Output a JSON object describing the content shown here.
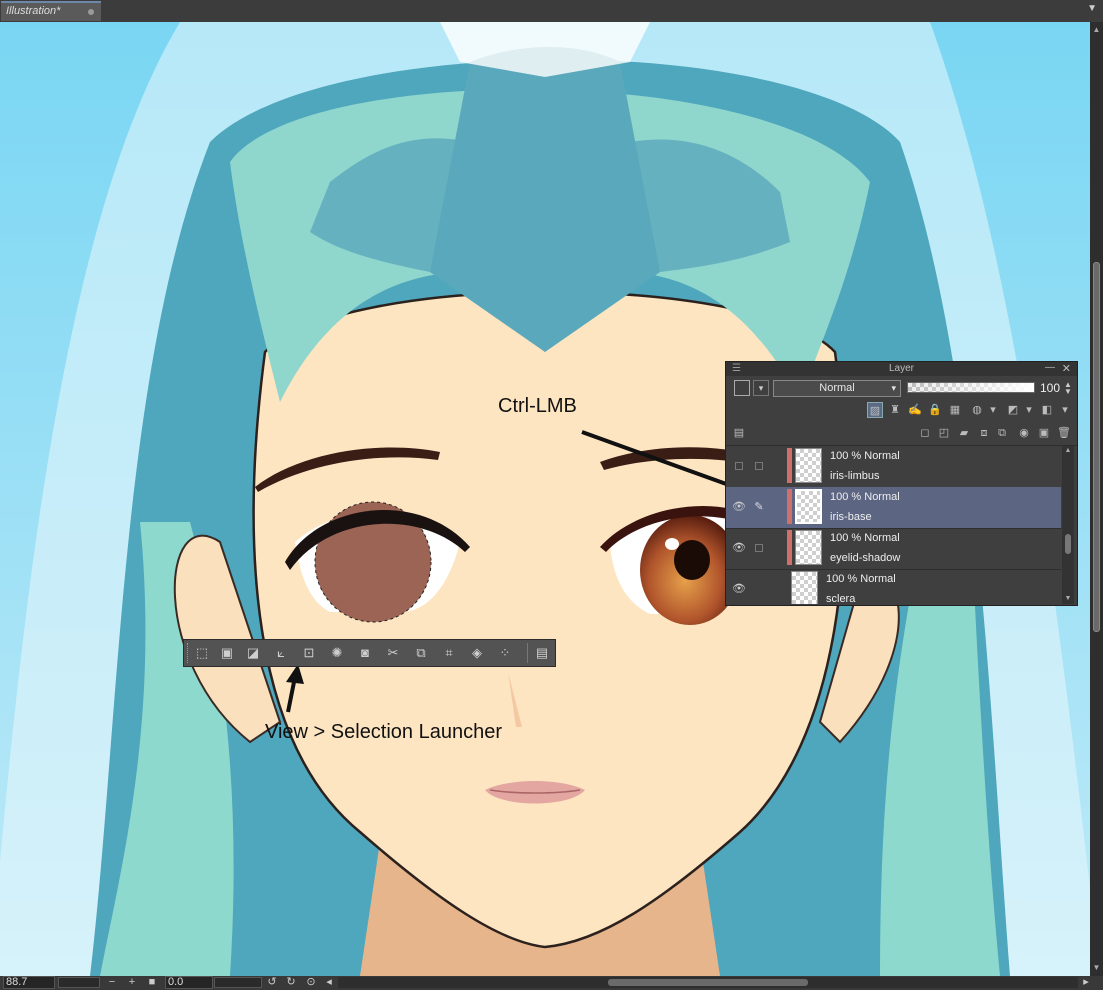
{
  "document_tab": {
    "title": "Illustration*"
  },
  "annotations": {
    "ctrl_lmb": "Ctrl-LMB",
    "selection_launcher": "View > Selection Launcher"
  },
  "status_bar": {
    "zoom": "88.7",
    "rotation": "0.0"
  },
  "selection_launcher": {
    "buttons": [
      "deselect-icon",
      "invert-selection-icon",
      "expand-selection-icon",
      "shrink-selection-icon",
      "transform-selection-icon",
      "convert-to-selection-layer-icon",
      "border-selection-icon",
      "clear-outside-icon",
      "cut-paste-icon",
      "copy-paste-icon",
      "crop-icon",
      "fill-icon",
      "screentone-icon",
      "launcher-settings-icon"
    ]
  },
  "layer_panel": {
    "title": "Layer",
    "blend_mode": "Normal",
    "opacity": "100",
    "accent_color": "#5c6683",
    "clip_color": "#d0706d",
    "layers": [
      {
        "mode": "100 % Normal",
        "name": "iris-limbus",
        "visible": false,
        "clipped": true,
        "selected": false
      },
      {
        "mode": "100 % Normal",
        "name": "iris-base",
        "visible": true,
        "clipped": true,
        "selected": true
      },
      {
        "mode": "100 % Normal",
        "name": "eyelid-shadow",
        "visible": true,
        "clipped": true,
        "selected": false
      },
      {
        "mode": "100 % Normal",
        "name": "sclera",
        "visible": true,
        "clipped": false,
        "selected": false
      }
    ]
  }
}
